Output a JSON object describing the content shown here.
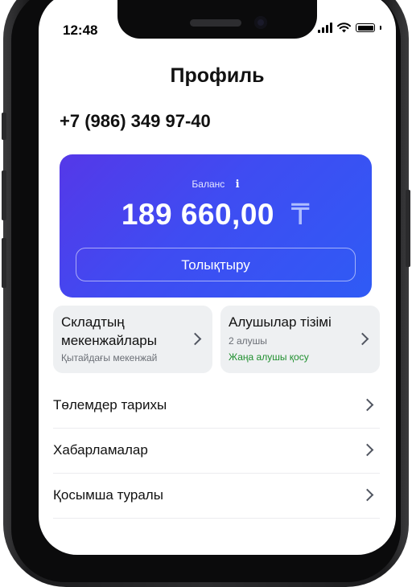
{
  "status_bar": {
    "time": "12:48"
  },
  "header": {
    "title": "Профиль"
  },
  "profile": {
    "phone": "+7 (986) 349 97-40"
  },
  "balance": {
    "label": "Баланс",
    "info_icon": "i",
    "amount": "189 660,00",
    "currency_symbol": "₸",
    "topup_label": "Толықтыру"
  },
  "tiles": [
    {
      "title": "Складтың мекенжайлары",
      "subtitle": "Қытайдағы мекенжай"
    },
    {
      "title": "Алушылар тізімі",
      "subtitle": "2 алушы",
      "link": "Жаңа алушы қосу"
    }
  ],
  "menu": [
    {
      "label": "Төлемдер тарихы"
    },
    {
      "label": "Хабарламалар"
    },
    {
      "label": "Қосымша туралы"
    }
  ],
  "colors": {
    "card_gradient_start": "#5538e8",
    "card_gradient_end": "#2f5bf5",
    "link_green": "#1f8f2e",
    "tile_bg": "#eef0f2"
  }
}
